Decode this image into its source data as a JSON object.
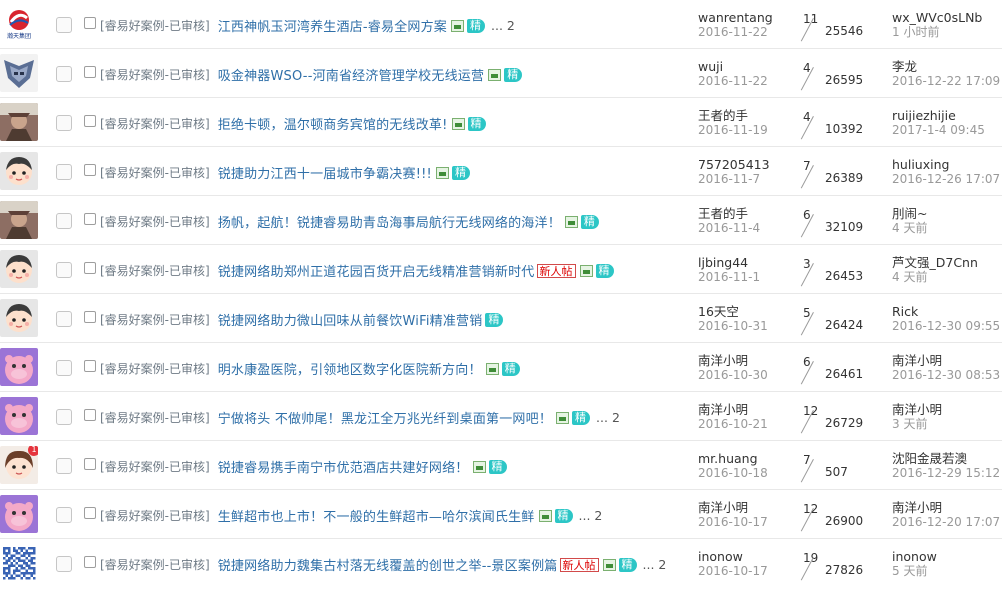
{
  "threads": [
    {
      "category": "[睿易好案例-已审核]",
      "subject": "江西神帆玉河湾养生酒店-睿易全网方案",
      "icons": [
        "image-icon",
        "jing-badge"
      ],
      "new_label": "",
      "page_label": "... 2",
      "author": "wanrentang",
      "post_date": "2016-11-22",
      "replies": "11",
      "views": "25546",
      "last_poster": "wx_WVc0sLNb",
      "last_time": "1 小时前",
      "avatar": "hantian-logo",
      "avatar_badge": ""
    },
    {
      "category": "[睿易好案例-已审核]",
      "subject": "吸金神器WSO--河南省经济管理学校无线运营",
      "icons": [
        "image-icon",
        "jing-badge"
      ],
      "new_label": "",
      "page_label": "",
      "author": "wuji",
      "post_date": "2016-11-22",
      "replies": "4",
      "views": "26595",
      "last_poster": "李龙",
      "last_time": "2016-12-22 17:09",
      "avatar": "transformer",
      "avatar_badge": ""
    },
    {
      "category": "[睿易好案例-已审核]",
      "subject": "拒绝卡顿，温尔顿商务宾馆的无线改革!",
      "icons": [
        "image-icon",
        "jing-badge"
      ],
      "new_label": "",
      "page_label": "",
      "author": "王者的手",
      "post_date": "2016-11-19",
      "replies": "4",
      "views": "10392",
      "last_poster": "ruijiezhijie",
      "last_time": "2017-1-4 09:45",
      "avatar": "warrior",
      "avatar_badge": ""
    },
    {
      "category": "[睿易好案例-已审核]",
      "subject": "锐捷助力江西十一届城市争霸决赛!!!",
      "icons": [
        "image-icon",
        "jing-badge"
      ],
      "new_label": "",
      "page_label": "",
      "author": "757205413",
      "post_date": "2016-11-7",
      "replies": "7",
      "views": "26389",
      "last_poster": "huliuxing",
      "last_time": "2016-12-26 17:07",
      "avatar": "cartoon-boy",
      "avatar_badge": ""
    },
    {
      "category": "[睿易好案例-已审核]",
      "subject": "扬帆，起航！锐捷睿易助青岛海事局航行无线网络的海洋！",
      "icons": [
        "image-icon",
        "jing-badge"
      ],
      "new_label": "",
      "page_label": "",
      "author": "王者的手",
      "post_date": "2016-11-4",
      "replies": "6",
      "views": "32109",
      "last_poster": "刖闹~",
      "last_time": "4 天前",
      "avatar": "warrior",
      "avatar_badge": ""
    },
    {
      "category": "[睿易好案例-已审核]",
      "subject": "锐捷网络助郑州正道花园百货开启无线精准营销新时代",
      "icons": [
        "image-icon",
        "jing-badge"
      ],
      "new_label": "新人帖",
      "page_label": "",
      "author": "ljbing44",
      "post_date": "2016-11-1",
      "replies": "3",
      "views": "26453",
      "last_poster": "芦文强_D7Cnn",
      "last_time": "4 天前",
      "avatar": "cartoon-boy",
      "avatar_badge": ""
    },
    {
      "category": "[睿易好案例-已审核]",
      "subject": "锐捷网络助力微山回味从前餐饮WiFi精准营销",
      "icons": [
        "jing-badge"
      ],
      "new_label": "",
      "page_label": "",
      "author": "16天空",
      "post_date": "2016-10-31",
      "replies": "5",
      "views": "26424",
      "last_poster": "Rick",
      "last_time": "2016-12-30 09:55",
      "avatar": "cartoon-boy",
      "avatar_badge": ""
    },
    {
      "category": "[睿易好案例-已审核]",
      "subject": "明水康盈医院，引领地区数字化医院新方向！",
      "icons": [
        "image-icon",
        "jing-badge"
      ],
      "new_label": "",
      "page_label": "",
      "author": "南洋小明",
      "post_date": "2016-10-30",
      "replies": "6",
      "views": "26461",
      "last_poster": "南洋小明",
      "last_time": "2016-12-30 08:53",
      "avatar": "pink-character",
      "avatar_badge": ""
    },
    {
      "category": "[睿易好案例-已审核]",
      "subject": "宁做将头 不做帅尾！黑龙江全万兆光纤到桌面第一网吧！",
      "icons": [
        "image-icon",
        "jing-badge"
      ],
      "new_label": "",
      "page_label": "... 2",
      "author": "南洋小明",
      "post_date": "2016-10-21",
      "replies": "12",
      "views": "26729",
      "last_poster": "南洋小明",
      "last_time": "3 天前",
      "avatar": "pink-character",
      "avatar_badge": ""
    },
    {
      "category": "[睿易好案例-已审核]",
      "subject": "锐捷睿易携手南宁市优范酒店共建好网络！",
      "icons": [
        "image-icon",
        "jing-badge"
      ],
      "new_label": "",
      "page_label": "",
      "author": "mr.huang",
      "post_date": "2016-10-18",
      "replies": "7",
      "views": "507",
      "last_poster": "沈阳金晟若澳",
      "last_time": "2016-12-29 15:12",
      "avatar": "cartoon-girl",
      "avatar_badge": "1"
    },
    {
      "category": "[睿易好案例-已审核]",
      "subject": "生鲜超市也上市！不一般的生鲜超市—哈尔滨闻氏生鲜",
      "icons": [
        "image-icon",
        "jing-badge"
      ],
      "new_label": "",
      "page_label": "... 2",
      "author": "南洋小明",
      "post_date": "2016-10-17",
      "replies": "12",
      "views": "26900",
      "last_poster": "南洋小明",
      "last_time": "2016-12-20 17:07",
      "avatar": "pink-character",
      "avatar_badge": ""
    },
    {
      "category": "[睿易好案例-已审核]",
      "subject": "锐捷网络助力魏集古村落无线覆盖的创世之举--景区案例篇",
      "icons": [
        "image-icon",
        "jing-badge"
      ],
      "new_label": "新人帖",
      "page_label": "... 2",
      "author": "inonow",
      "post_date": "2016-10-17",
      "replies": "19",
      "views": "27826",
      "last_poster": "inonow",
      "last_time": "5 天前",
      "avatar": "qr-code",
      "avatar_badge": ""
    }
  ],
  "labels": {
    "jing": "精",
    "hantian_logo_text": "瀚天集团"
  },
  "colors": {
    "subject": "#2f6fa8",
    "category": "#6f7b86",
    "jing_badge": "#2cc6c6",
    "new_badge": "#d00000",
    "date": "#999999"
  }
}
